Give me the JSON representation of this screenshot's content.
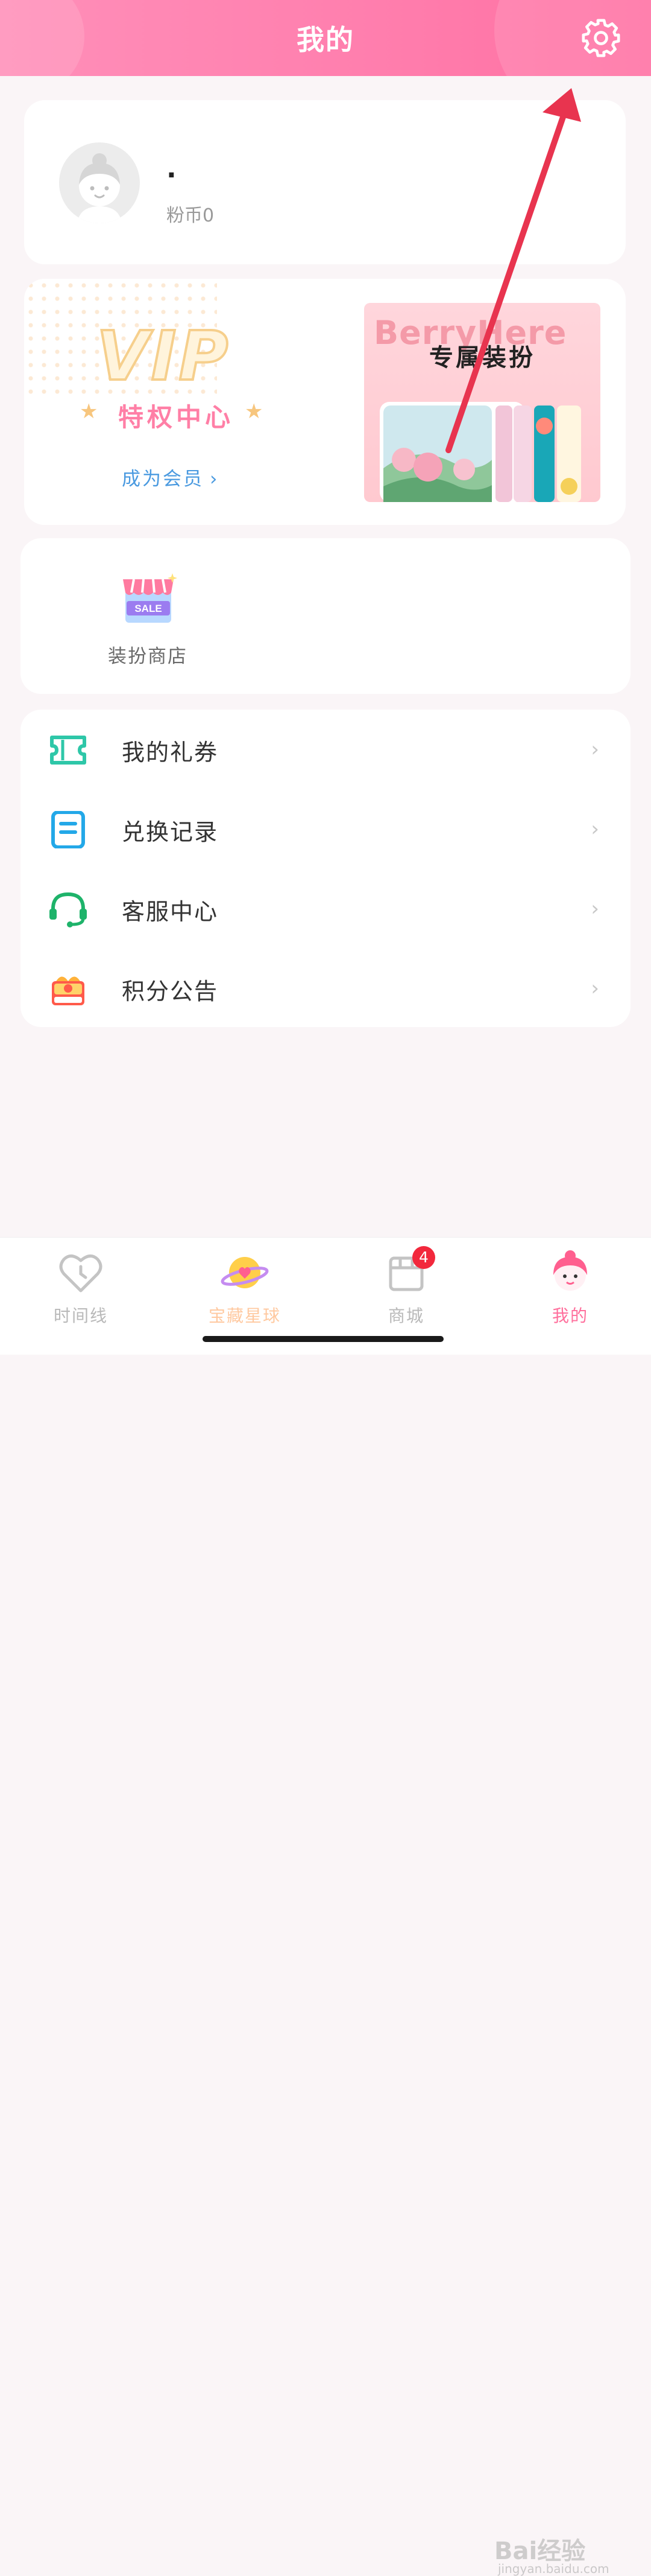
{
  "header": {
    "title": "我的",
    "settings_icon": "gear-icon",
    "bg_color": "#ff7fae"
  },
  "profile": {
    "username": ".",
    "coins": "粉币0"
  },
  "vip": {
    "logo_text": "VIP",
    "subtitle": "特权中心",
    "link_label": "成为会员",
    "link_chevron": "›",
    "promo_title_en": "BerryHere",
    "promo_title_cn": "专属装扮",
    "link_color": "#4a9ae0",
    "subtitle_color": "#ff7fa6"
  },
  "shop": {
    "item_label": "装扮商店",
    "icon_text": "SALE"
  },
  "menu": {
    "items": [
      {
        "label": "我的礼券",
        "icon": "ticket-icon",
        "chevron": "›",
        "color": "#2ec7a8"
      },
      {
        "label": "兑换记录",
        "icon": "record-icon",
        "chevron": "›",
        "color": "#23a8e8"
      },
      {
        "label": "客服中心",
        "icon": "headset-icon",
        "chevron": "›",
        "color": "#1eb36a"
      },
      {
        "label": "积分公告",
        "icon": "gift-box-icon",
        "chevron": "›",
        "color": "#ff5a4a"
      }
    ]
  },
  "tabbar": {
    "tabs": [
      {
        "label": "时间线",
        "icon": "heart-clock-icon",
        "active": false
      },
      {
        "label": "宝藏星球",
        "icon": "planet-icon",
        "active": false
      },
      {
        "label": "商城",
        "icon": "store-icon",
        "active": false,
        "badge": "4"
      },
      {
        "label": "我的",
        "icon": "girl-avatar-icon",
        "active": true
      }
    ],
    "active_color": "#ff6f9c",
    "inactive_color": "#b9b9b9"
  },
  "watermark": {
    "text": "Bai经验",
    "sub": "jingyan.baidu.com"
  },
  "annotation": {
    "arrow_color": "#e8344f"
  }
}
